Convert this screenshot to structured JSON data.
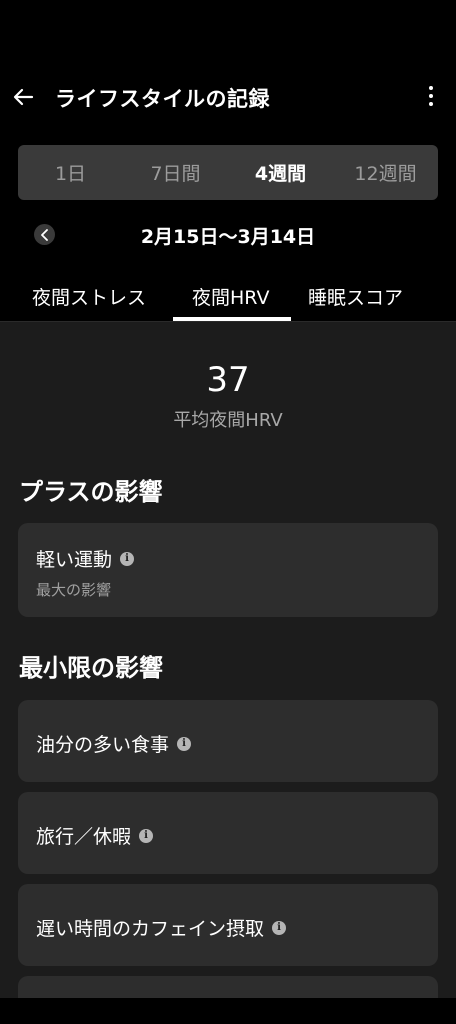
{
  "header": {
    "title": "ライフスタイルの記録",
    "back_icon": "arrow-left-icon",
    "menu_icon": "more-vertical-icon"
  },
  "periods": [
    {
      "label": "1日",
      "active": false
    },
    {
      "label": "7日間",
      "active": false
    },
    {
      "label": "4週間",
      "active": true
    },
    {
      "label": "12週間",
      "active": false
    }
  ],
  "date_range": {
    "text": "2月15日〜3月14日",
    "prev_icon": "chevron-left-icon"
  },
  "tabs": [
    {
      "label": "夜間ストレス",
      "active": false
    },
    {
      "label": "夜間HRV",
      "active": true
    },
    {
      "label": "睡眠スコア",
      "active": false
    }
  ],
  "summary": {
    "value": "37",
    "label": "平均夜間HRV"
  },
  "positive": {
    "title": "プラスの影響",
    "items": [
      {
        "label": "軽い運動",
        "sub": "最大の影響"
      }
    ]
  },
  "minimal": {
    "title": "最小限の影響",
    "items": [
      {
        "label": "油分の多い食事"
      },
      {
        "label": "旅行／休暇"
      },
      {
        "label": "遅い時間のカフェイン摂取"
      }
    ]
  },
  "colors": {
    "background": "#000000",
    "panel": "#1c1c1c",
    "card": "#2d2d2d",
    "segment": "#3a3a3a",
    "muted_text": "#a0a0a0"
  }
}
